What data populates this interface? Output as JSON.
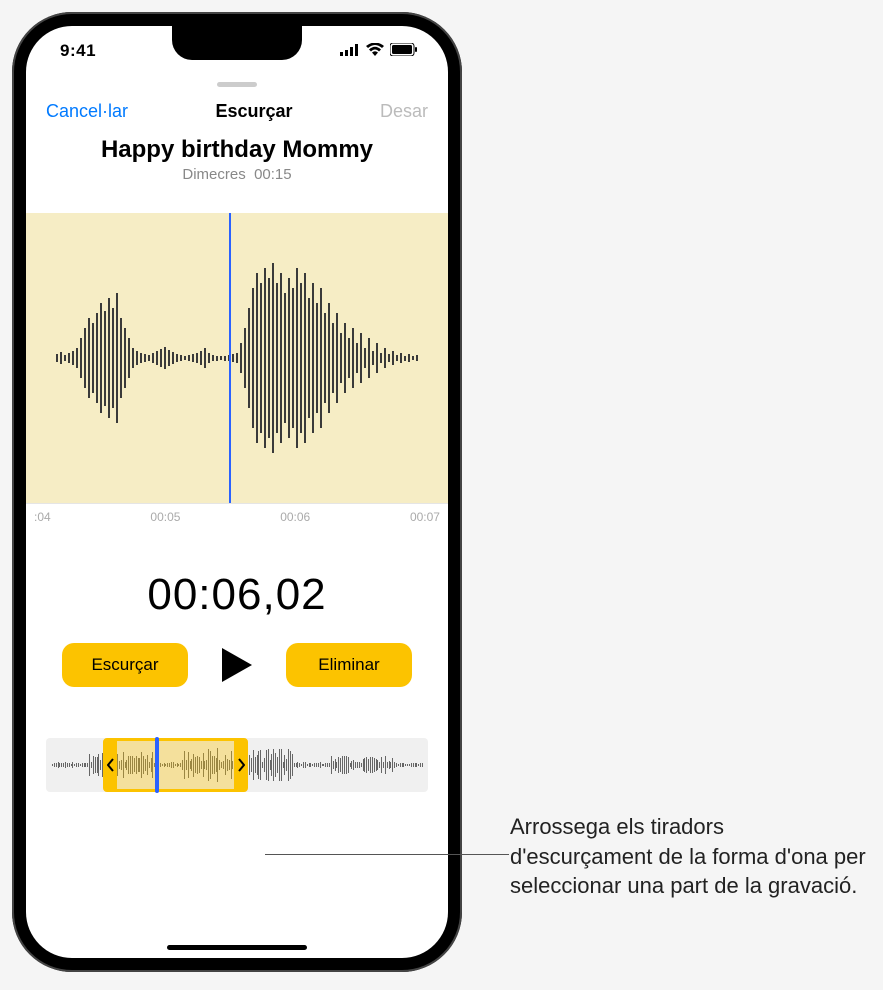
{
  "status_bar": {
    "time": "9:41"
  },
  "nav": {
    "cancel": "Cancel·lar",
    "title": "Escurçar",
    "save": "Desar"
  },
  "recording": {
    "title": "Happy birthday Mommy",
    "day": "Dimecres",
    "duration": "00:15"
  },
  "ruler": {
    "t0": ":04",
    "t1": "00:05",
    "t2": "00:06",
    "t3": "00:07"
  },
  "timer": "00:06,02",
  "buttons": {
    "trim": "Escurçar",
    "delete": "Eliminar"
  },
  "callout": {
    "text": "Arrossega els tiradors d'escurçament de la forma d'ona per seleccionar una part de la gravació."
  }
}
